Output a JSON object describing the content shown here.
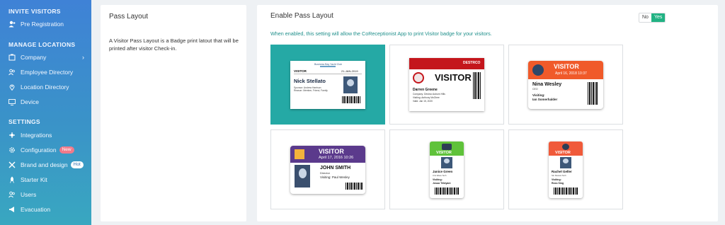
{
  "sidebar": {
    "sections": [
      {
        "label": "INVITE VISITORS"
      },
      {
        "label": "MANAGE LOCATIONS"
      },
      {
        "label": "SETTINGS"
      }
    ],
    "items": [
      {
        "label": "Pre Registration",
        "icon": "user-plus-icon"
      },
      {
        "label": "Company",
        "icon": "company-icon"
      },
      {
        "label": "Employee Directory",
        "icon": "users-icon"
      },
      {
        "label": "Location Directory",
        "icon": "location-pin-icon"
      },
      {
        "label": "Device",
        "icon": "monitor-icon"
      },
      {
        "label": "Integrations",
        "icon": "integrations-icon"
      },
      {
        "label": "Configuration",
        "icon": "gear-icon",
        "badge": "New"
      },
      {
        "label": "Brand and design",
        "icon": "brush-icon",
        "badge": "Hot"
      },
      {
        "label": "Starter Kit",
        "icon": "rocket-icon"
      },
      {
        "label": "Users",
        "icon": "users-icon"
      },
      {
        "label": "Evacuation",
        "icon": "megaphone-icon"
      }
    ]
  },
  "left_panel": {
    "title": "Pass Layout",
    "description": "A Visitor Pass Layout is a Badge print latout that will be printed after visitor Check-in."
  },
  "right_panel": {
    "title": "Enable Pass Layout",
    "hint": "When enabled, this setting will allow the CoReceptionist App to print Visitor badge for your visitors.",
    "toggle": {
      "no": "No",
      "yes": "Yes",
      "selected": "Yes"
    }
  },
  "layouts": [
    {
      "selected": true,
      "company": "Business Bay Yacht Club",
      "label": "VISITOR",
      "date": "21-JAN-2019",
      "name": "Nick Stellato",
      "sponsor": "Sponsor: Andrew Harrison",
      "reason": "Reason: Member, Friend, Family"
    },
    {
      "selected": false,
      "brand": "DESTRCO",
      "label": "VISITOR",
      "name": "Darren Greene",
      "company": "Company: Destrco Auburn Hills",
      "visiting": "Visiting: Anthony McGhee",
      "valid": "Valid: Jan 15, 2020"
    },
    {
      "selected": false,
      "label": "VISITOR",
      "date": "April 16, 2018 10:37",
      "name": "Nina Wesley",
      "role": "CEO",
      "visiting_label": "Visiting:",
      "visiting": "Ian Somerhalder"
    },
    {
      "selected": false,
      "label": "VISITOR",
      "date": "April 17, 2016 10:26",
      "name": "JOHN SMITH",
      "role": "Director",
      "visiting": "Visiting: Paul Wesley"
    },
    {
      "selected": false,
      "label": "VISITOR",
      "name": "Janice Green",
      "role": "Cris Wave Tech",
      "visiting_label": "Visiting:",
      "visiting": "Josua Tribiyani"
    },
    {
      "selected": false,
      "label": "VISITOR",
      "name": "Rachel Geller",
      "role": "Sin Review Tech",
      "visiting_label": "Visiting:",
      "visiting": "Ross Sing"
    }
  ],
  "colors": {
    "accent_teal": "#25a9a5",
    "toggle_on": "#21b283",
    "visitor_orange": "#f05a2a",
    "visitor_purple": "#5b3a8c",
    "visitor_green": "#5fc23a",
    "visitor_red": "#f05a3a",
    "destrco_red": "#c4161c"
  }
}
